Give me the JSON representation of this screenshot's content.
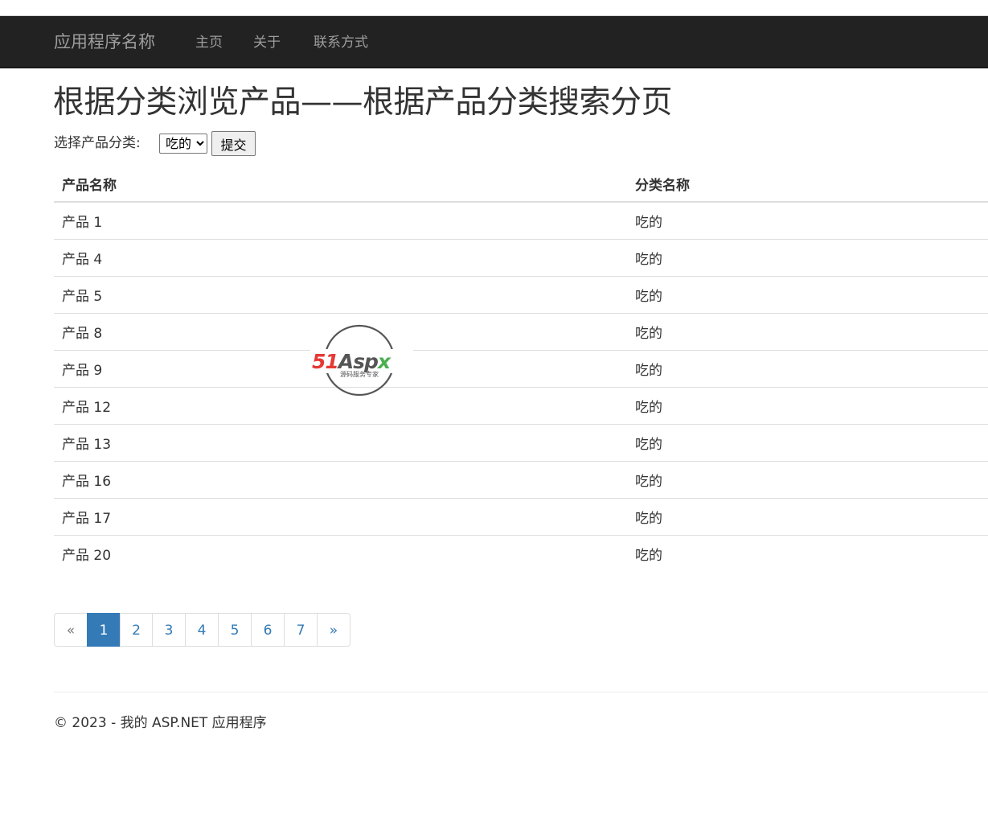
{
  "navbar": {
    "brand": "应用程序名称",
    "links": [
      {
        "label": "主页"
      },
      {
        "label": "关于"
      },
      {
        "label": "联系方式"
      }
    ]
  },
  "page": {
    "title": "根据分类浏览产品——根据产品分类搜索分页"
  },
  "filter": {
    "label": "选择产品分类:",
    "selected_category": "吃的",
    "submit_label": "提交"
  },
  "table": {
    "headers": [
      "产品名称",
      "分类名称"
    ],
    "rows": [
      [
        "产品 1",
        "吃的"
      ],
      [
        "产品 4",
        "吃的"
      ],
      [
        "产品 5",
        "吃的"
      ],
      [
        "产品 8",
        "吃的"
      ],
      [
        "产品 9",
        "吃的"
      ],
      [
        "产品 12",
        "吃的"
      ],
      [
        "产品 13",
        "吃的"
      ],
      [
        "产品 16",
        "吃的"
      ],
      [
        "产品 17",
        "吃的"
      ],
      [
        "产品 20",
        "吃的"
      ]
    ]
  },
  "pagination": {
    "prev": "«",
    "next": "»",
    "pages": [
      "1",
      "2",
      "3",
      "4",
      "5",
      "6",
      "7"
    ],
    "current": "1"
  },
  "footer": {
    "text": "© 2023 - 我的 ASP.NET 应用程序"
  },
  "watermark": {
    "brand_red": "51",
    "brand_dark": "Asp",
    "brand_green": "x",
    "tagline": "源码服务专家"
  },
  "colors": {
    "navbar_bg": "#222222",
    "link": "#337ab7",
    "active_page": "#337ab7"
  }
}
